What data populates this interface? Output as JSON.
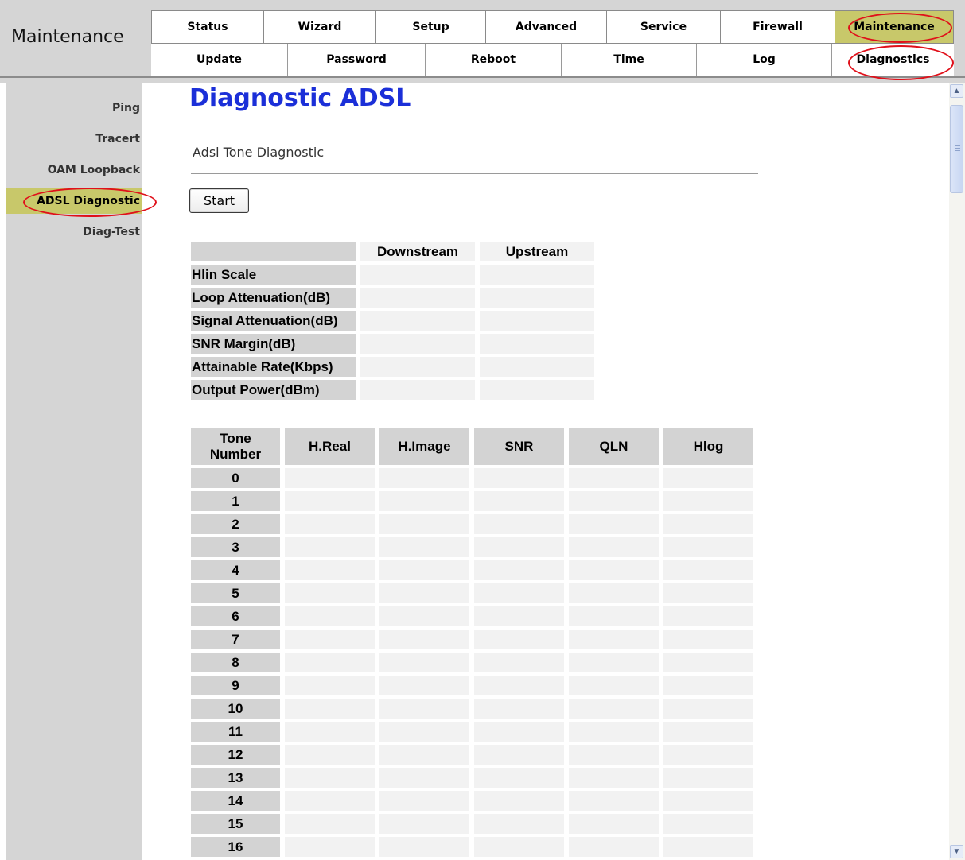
{
  "header": {
    "section_title": "Maintenance",
    "main_tabs": [
      {
        "label": "Status"
      },
      {
        "label": "Wizard"
      },
      {
        "label": "Setup"
      },
      {
        "label": "Advanced"
      },
      {
        "label": "Service"
      },
      {
        "label": "Firewall"
      },
      {
        "label": "Maintenance",
        "active": true
      }
    ],
    "sub_tabs": [
      {
        "label": "Update"
      },
      {
        "label": "Password"
      },
      {
        "label": "Reboot"
      },
      {
        "label": "Time"
      },
      {
        "label": "Log"
      },
      {
        "label": "Diagnostics",
        "active": true
      }
    ]
  },
  "sidebar": {
    "items": [
      {
        "label": "Ping"
      },
      {
        "label": "Tracert"
      },
      {
        "label": "OAM Loopback"
      },
      {
        "label": "ADSL Diagnostic",
        "active": true
      },
      {
        "label": "Diag-Test"
      }
    ]
  },
  "main": {
    "title": "Diagnostic ADSL",
    "subtitle": "Adsl Tone Diagnostic",
    "start_button": "Start",
    "stats_table": {
      "columns": [
        "Downstream",
        "Upstream"
      ],
      "rows": [
        "Hlin Scale",
        "Loop Attenuation(dB)",
        "Signal Attenuation(dB)",
        "SNR Margin(dB)",
        "Attainable Rate(Kbps)",
        "Output Power(dBm)"
      ]
    },
    "tone_table": {
      "header_tone": "Tone Number",
      "columns": [
        "H.Real",
        "H.Image",
        "SNR",
        "QLN",
        "Hlog"
      ],
      "tones": [
        "0",
        "1",
        "2",
        "3",
        "4",
        "5",
        "6",
        "7",
        "8",
        "9",
        "10",
        "11",
        "12",
        "13",
        "14",
        "15",
        "16"
      ]
    }
  },
  "colors": {
    "accent_active": "#c8c86a",
    "title_blue": "#1b2fd8",
    "annotation_red": "#e0101a"
  },
  "icons": {
    "scroll_up": "chevron-up-icon",
    "scroll_down": "chevron-down-icon"
  }
}
